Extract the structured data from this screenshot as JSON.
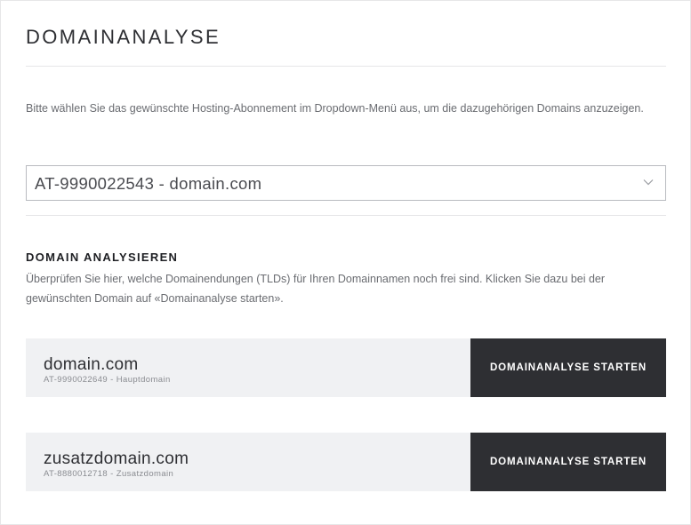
{
  "page": {
    "title": "DOMAINANALYSE",
    "intro": "Bitte wählen Sie das gewünschte Hosting-Abonnement im Dropdown-Menü aus, um die dazugehörigen Domains anzuzeigen."
  },
  "subscription_select": {
    "selected": "AT-9990022543 - domain.com",
    "icon": "chevron-down-icon"
  },
  "analysis": {
    "heading": "DOMAIN ANALYSIEREN",
    "description": "Überprüfen Sie hier, welche Domainendungen (TLDs) für Ihren Domainnamen noch frei sind. Klicken Sie dazu bei der gewünschten Domain auf «Domainanalyse starten».",
    "domains": [
      {
        "name": "domain.com",
        "meta": "AT-9990022649 - Hauptdomain",
        "button_label": "DOMAINANALYSE STARTEN"
      },
      {
        "name": "zusatzdomain.com",
        "meta": "AT-8880012718 - Zusatzdomain",
        "button_label": "DOMAINANALYSE STARTEN"
      }
    ]
  },
  "colors": {
    "row_background": "#f0f1f3",
    "button_background": "#2e2f33",
    "button_text": "#ffffff",
    "divider": "#e6e6e8"
  }
}
